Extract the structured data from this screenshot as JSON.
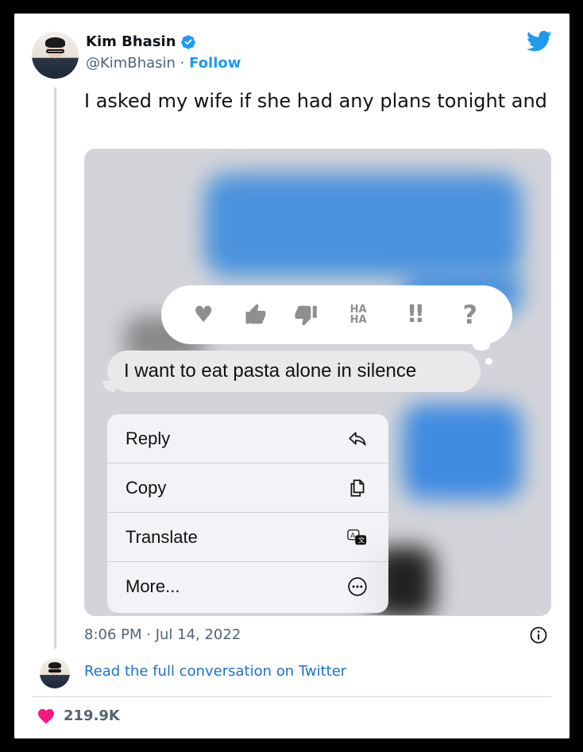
{
  "author": {
    "name": "Kim Bhasin",
    "handle": "@KimBhasin",
    "separator": "·",
    "follow_label": "Follow",
    "verified_icon": "verified-badge-icon"
  },
  "tweet": {
    "text": "I asked my wife if she had any plans tonight and"
  },
  "media": {
    "reactions": [
      "heart",
      "thumbs-up",
      "thumbs-down",
      "HA HA",
      "!!",
      "?"
    ],
    "haha_line1": "HA",
    "haha_line2": "HA",
    "exclaim": "!!",
    "question": "?",
    "message_text": "I want to eat pasta alone in silence",
    "menu": [
      {
        "label": "Reply",
        "icon": "reply-icon"
      },
      {
        "label": "Copy",
        "icon": "copy-icon"
      },
      {
        "label": "Translate",
        "icon": "translate-icon"
      },
      {
        "label": "More...",
        "icon": "more-icon"
      }
    ]
  },
  "footer": {
    "timestamp": "8:06 PM · Jul 14, 2022",
    "read_full": "Read the full conversation on Twitter",
    "likes": "219.9K"
  },
  "colors": {
    "twitter_blue": "#1d9bf0",
    "heart_pink": "#f91880",
    "imessage_blue": "#3b8fe0"
  }
}
